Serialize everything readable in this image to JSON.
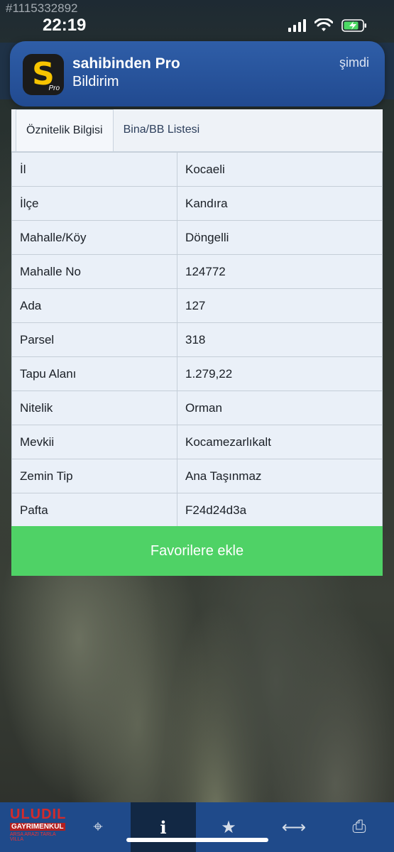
{
  "watermark_id": "#1115332892",
  "status_bar": {
    "time": "22:19"
  },
  "notification": {
    "app_icon_letter": "S",
    "app_icon_sub": "Pro",
    "title": "sahibinden Pro",
    "body": "Bildirim",
    "time": "şimdi"
  },
  "tabs": [
    {
      "label": "Öznitelik Bilgisi",
      "active": true
    },
    {
      "label": "Bina/BB Listesi",
      "active": false
    }
  ],
  "attributes": [
    {
      "key": "İl",
      "value": "Kocaeli"
    },
    {
      "key": "İlçe",
      "value": "Kandıra"
    },
    {
      "key": "Mahalle/Köy",
      "value": "Döngelli"
    },
    {
      "key": "Mahalle No",
      "value": "124772"
    },
    {
      "key": "Ada",
      "value": "127"
    },
    {
      "key": "Parsel",
      "value": "318"
    },
    {
      "key": "Tapu Alanı",
      "value": "1.279,22"
    },
    {
      "key": "Nitelik",
      "value": "Orman"
    },
    {
      "key": "Mevkii",
      "value": "Kocamezarlıkalt"
    },
    {
      "key": "Zemin Tip",
      "value": "Ana Taşınmaz"
    },
    {
      "key": "Pafta",
      "value": "F24d24d3a"
    }
  ],
  "favorite_button": "Favorilere ekle",
  "toolbar": {
    "logo_main": "ULUDIL",
    "logo_sub": "GAYRIMENKUL",
    "logo_sub2": "ARSA ARAZI TARLA VILLA",
    "buttons": [
      {
        "icon": "crosshair-icon",
        "glyph": "⌖"
      },
      {
        "icon": "info-icon",
        "glyph": "i"
      },
      {
        "icon": "star-icon",
        "glyph": "★"
      },
      {
        "icon": "measure-icon",
        "glyph": "⟷"
      },
      {
        "icon": "print-icon",
        "glyph": "⎙"
      }
    ]
  },
  "colors": {
    "favorite_button": "#4fd266",
    "notification_bg": "#2f5ea8",
    "toolbar_bg": "#1f4a8a"
  }
}
